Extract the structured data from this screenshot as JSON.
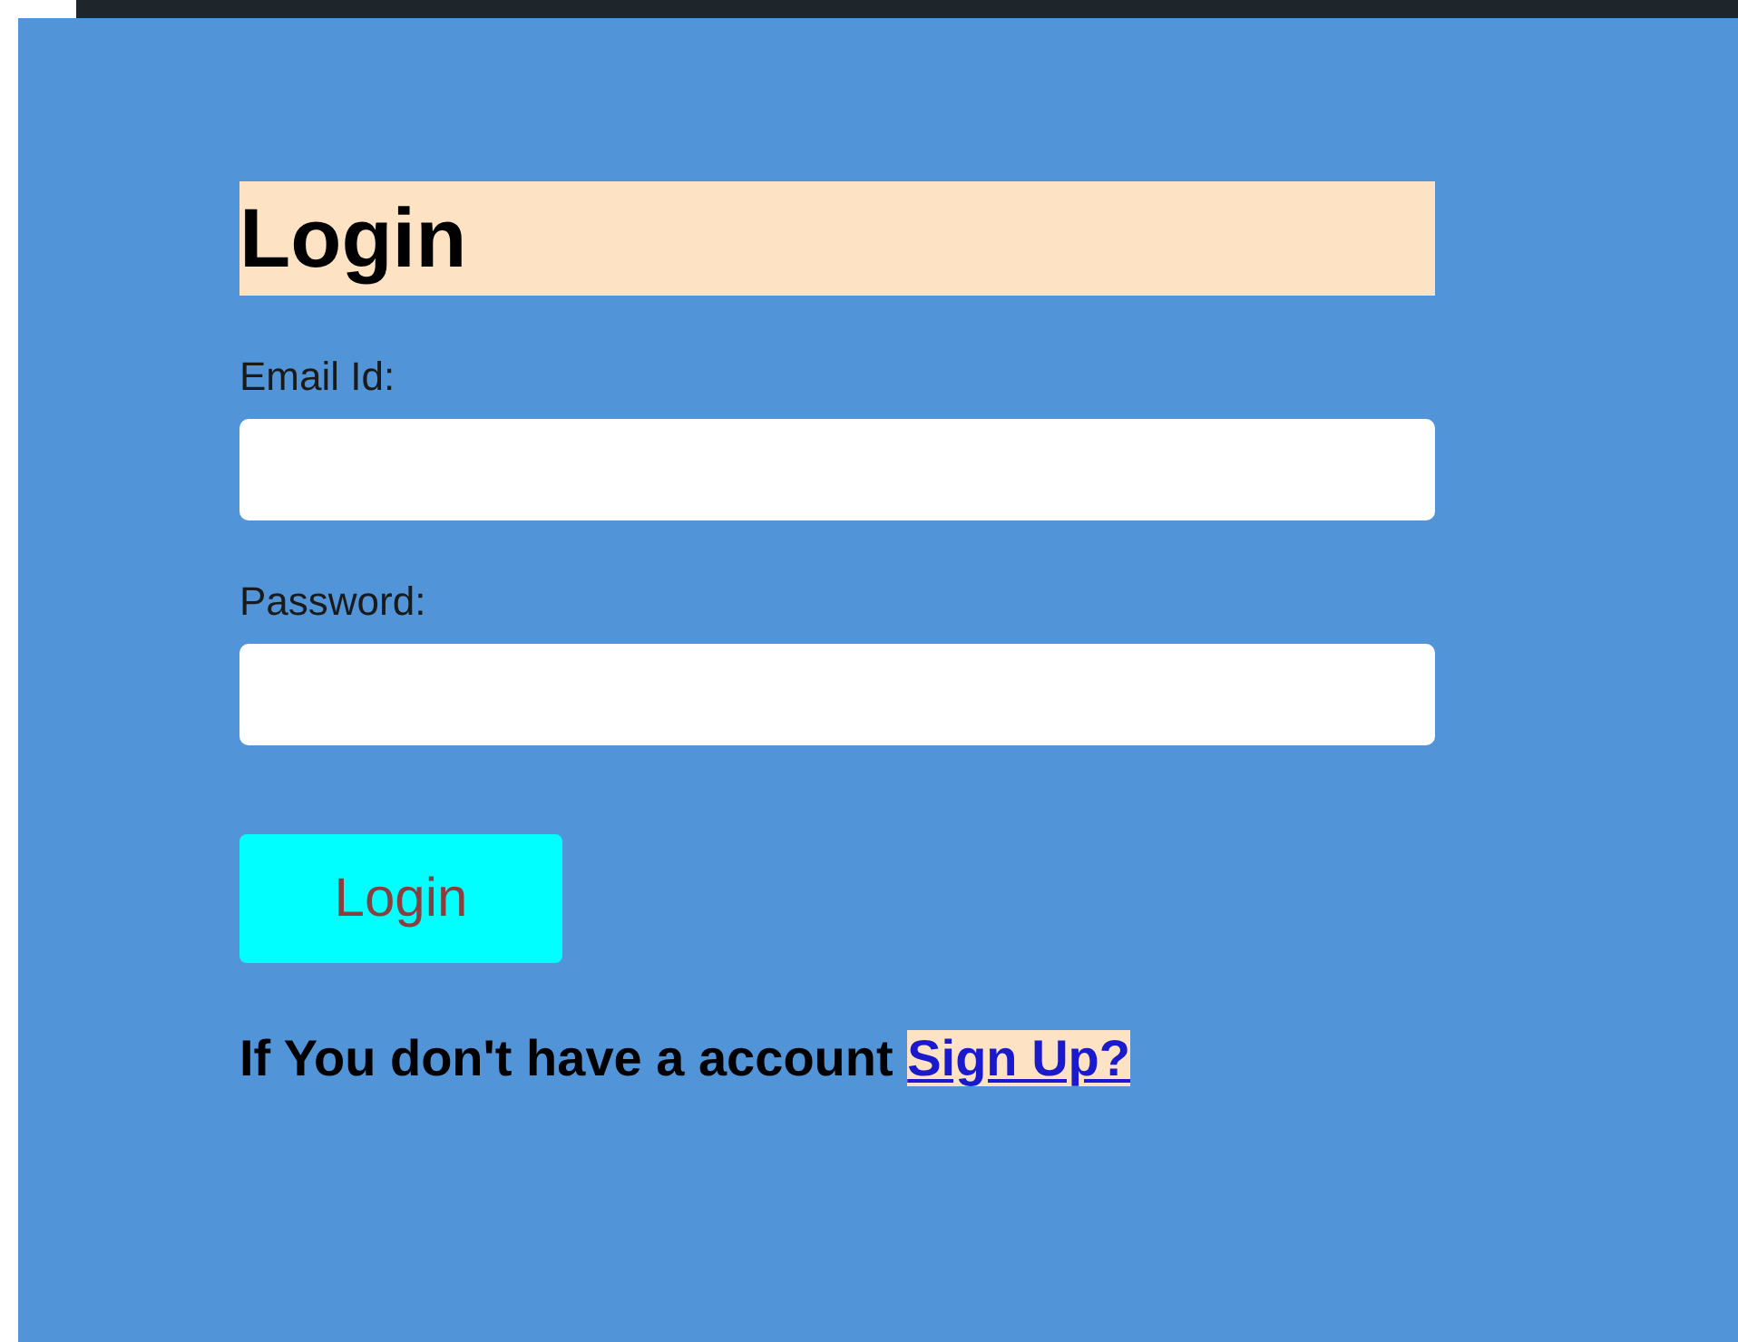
{
  "heading": "Login",
  "fields": [
    {
      "label": "Email Id:"
    },
    {
      "label": "Password:"
    }
  ],
  "button": "Login",
  "signup": {
    "text": "If You don't have a account",
    "link": "Sign Up?"
  }
}
